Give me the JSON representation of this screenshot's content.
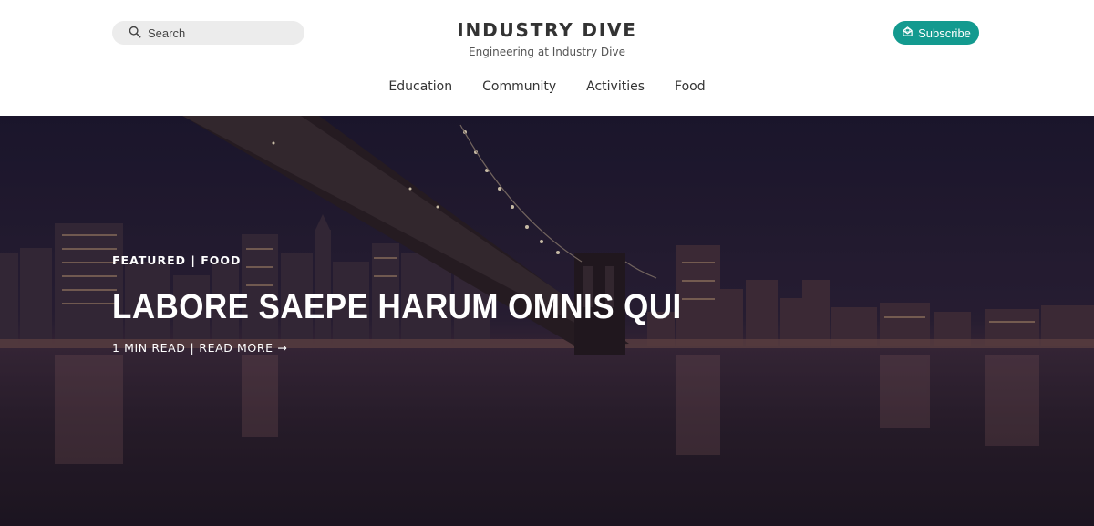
{
  "header": {
    "search": {
      "placeholder": "Search",
      "icon": "search-icon"
    },
    "brand": {
      "title": "INDUSTRY DIVE",
      "subtitle": "Engineering at Industry Dive"
    },
    "subscribe": {
      "label": "Subscribe",
      "icon": "envelope-icon",
      "color": "#139a8f"
    }
  },
  "nav": {
    "items": [
      {
        "label": "Education"
      },
      {
        "label": "Community"
      },
      {
        "label": "Activities"
      },
      {
        "label": "Food"
      }
    ]
  },
  "hero": {
    "kicker": "FEATURED | FOOD",
    "title": "LABORE SAEPE HARUM OMNIS QUI",
    "read_time": "1 MIN READ",
    "separator": "|",
    "read_more": "READ MORE →"
  }
}
